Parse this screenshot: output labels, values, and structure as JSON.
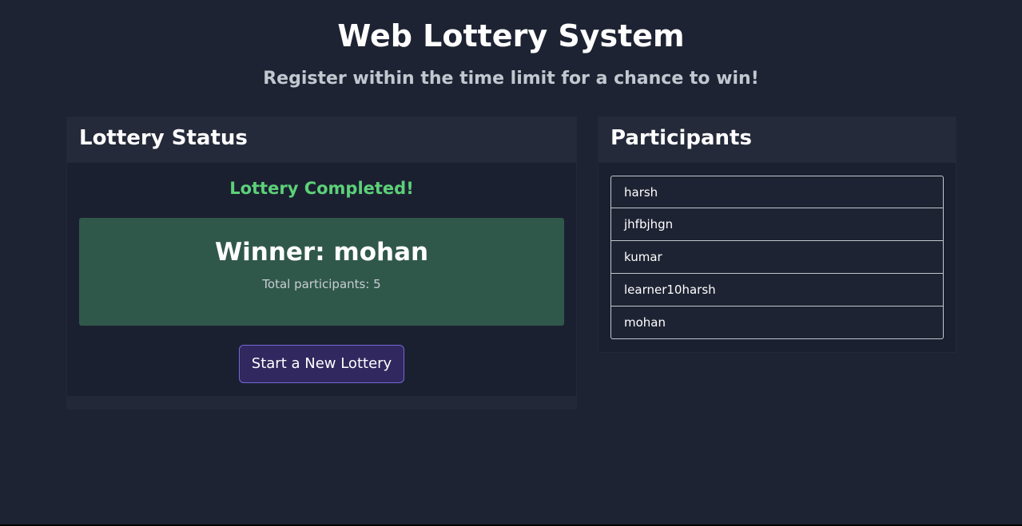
{
  "page": {
    "title": "Web Lottery System",
    "subtitle": "Register within the time limit for a chance to win!"
  },
  "status_card": {
    "title": "Lottery Status",
    "status_message": "Lottery Completed!",
    "winner_text": "Winner: mohan",
    "participant_count_text": "Total participants: 5",
    "new_lottery_button": "Start a New Lottery"
  },
  "participants_card": {
    "title": "Participants",
    "participants": [
      "harsh",
      "jhfbjhgn",
      "kumar",
      "learner10harsh",
      "mohan"
    ]
  },
  "colors": {
    "background": "#1e2333",
    "success_text": "#5cd178",
    "winner_box": "#30584a",
    "button_bg": "#30285e",
    "button_border": "#7367d6"
  }
}
